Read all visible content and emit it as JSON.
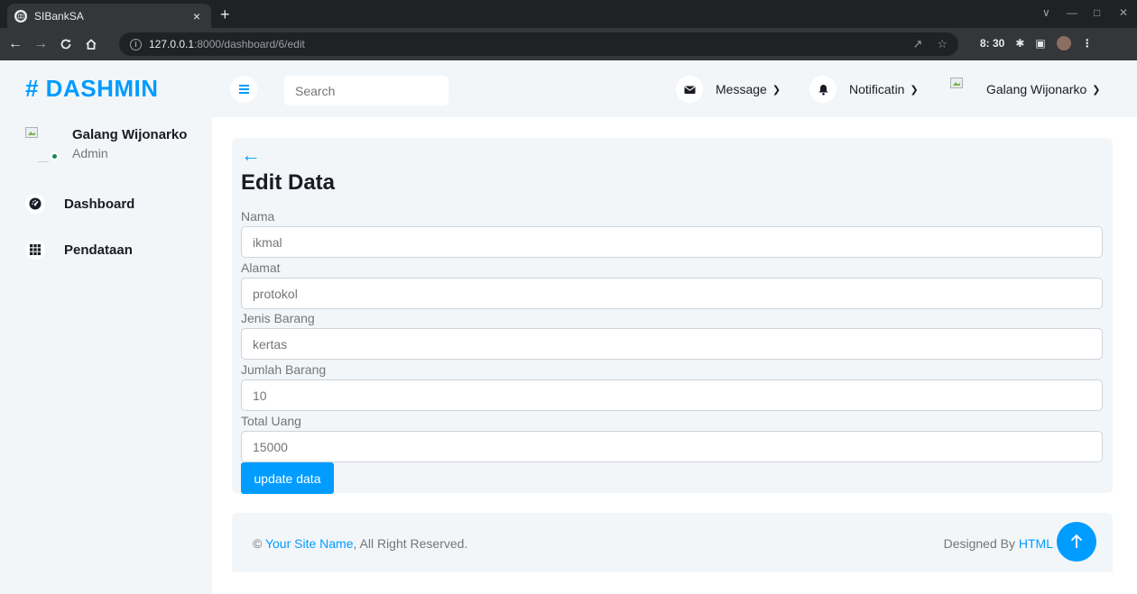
{
  "browser": {
    "tab_title": "SIBankSA",
    "tab_close": "×",
    "new_tab": "+",
    "url_host": "127.0.0.1",
    "url_path": ":8000/dashboard/6/edit",
    "clock": "8: 30"
  },
  "brand": "# DASHMIN",
  "sidebar": {
    "user_name": "Galang Wijonarko",
    "user_role": "Admin",
    "items": [
      {
        "label": "Dashboard",
        "icon": "tachometer-icon"
      },
      {
        "label": "Pendataan",
        "icon": "grid-icon"
      }
    ]
  },
  "topbar": {
    "search_placeholder": "Search",
    "message_label": "Message",
    "notification_label": "Notificatin",
    "user_name": "Galang Wijonarko"
  },
  "form": {
    "back_arrow": "←",
    "title": "Edit Data",
    "fields": [
      {
        "label": "Nama",
        "value": "ikmal"
      },
      {
        "label": "Alamat",
        "value": "protokol"
      },
      {
        "label": "Jenis Barang",
        "value": "kertas"
      },
      {
        "label": "Jumlah Barang",
        "value": "10"
      },
      {
        "label": "Total Uang",
        "value": "15000"
      }
    ],
    "submit_label": "update data"
  },
  "footer": {
    "copyright_prefix": "© ",
    "site_name": "Your Site Name",
    "copyright_suffix": ", All Right Reserved.",
    "designed_by": "Designed By ",
    "designer": "HTML"
  },
  "colors": {
    "primary": "#009cff",
    "light_bg": "#f3f6f9",
    "dark_text": "#191c24",
    "online": "#198754"
  }
}
